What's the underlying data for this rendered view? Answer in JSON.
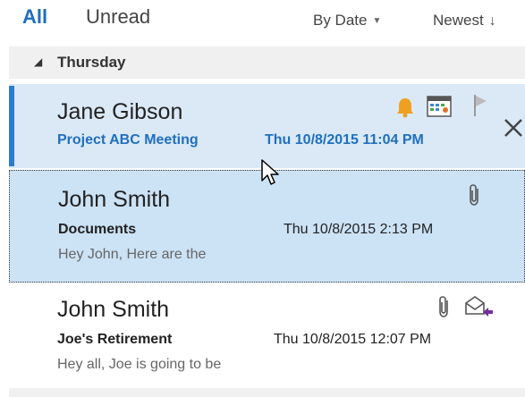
{
  "filter_bar": {
    "all_label": "All",
    "unread_label": "Unread",
    "sort_label": "By Date",
    "order_label": "Newest"
  },
  "group": {
    "label": "Thursday"
  },
  "messages": [
    {
      "sender": "Jane Gibson",
      "subject": "Project ABC Meeting",
      "date": "Thu 10/8/2015 11:04 PM",
      "preview": "",
      "icons": [
        "bell-icon",
        "calendar-icon",
        "flag-icon",
        "close-icon"
      ]
    },
    {
      "sender": "John Smith",
      "subject": "Documents",
      "date": "Thu 10/8/2015 2:13 PM",
      "preview": "Hey John,   Here are the",
      "icons": [
        "paperclip-icon"
      ]
    },
    {
      "sender": "John Smith",
      "subject": "Joe's Retirement",
      "date": "Thu 10/8/2015 12:07 PM",
      "preview": "Hey all,   Joe is going to be",
      "icons": [
        "paperclip-icon",
        "reply-icon"
      ]
    }
  ],
  "colors": {
    "accent": "#1f6fbf",
    "selected_bg": "#cce2f5",
    "hover_bg": "#dbe9f7",
    "bell": "#f0a020"
  }
}
